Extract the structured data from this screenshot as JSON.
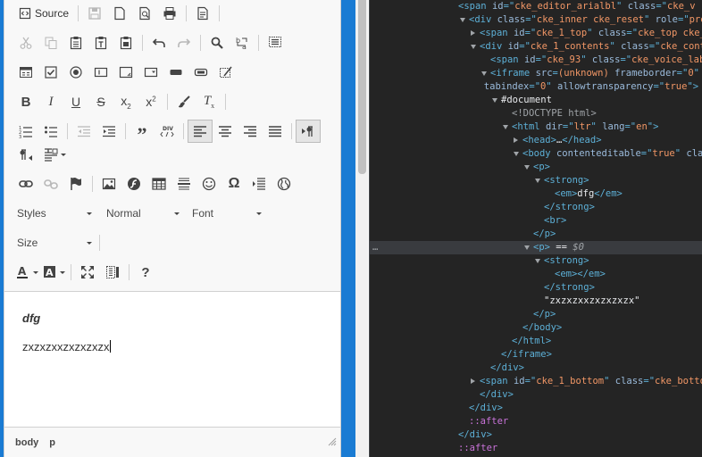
{
  "toolbar": {
    "source_label": "Source",
    "styles_label": "Styles",
    "format_label": "Normal",
    "font_label": "Font",
    "size_label": "Size",
    "help_label": "?"
  },
  "content": {
    "line1": "dfg",
    "line2": "zxzxzxxzxzxzxzx"
  },
  "status": {
    "path": [
      "body",
      "p"
    ]
  },
  "devtools": {
    "lines": [
      {
        "indent": 0,
        "parts": [
          [
            "t",
            "<span "
          ],
          [
            "a",
            "id"
          ],
          [
            "t",
            "=\""
          ],
          [
            "v",
            "cke_editor_arialbl"
          ],
          [
            "t",
            "\" "
          ],
          [
            "a",
            "class"
          ],
          [
            "t",
            "=\""
          ],
          [
            "v",
            "cke_v"
          ]
        ]
      },
      {
        "indent": 1,
        "tri": "down",
        "parts": [
          [
            "t",
            "<div "
          ],
          [
            "a",
            "class"
          ],
          [
            "t",
            "=\""
          ],
          [
            "v",
            "cke_inner cke_reset"
          ],
          [
            "t",
            "\" "
          ],
          [
            "a",
            "role"
          ],
          [
            "t",
            "=\""
          ],
          [
            "v",
            "pre"
          ]
        ]
      },
      {
        "indent": 2,
        "tri": "right",
        "parts": [
          [
            "t",
            "<span "
          ],
          [
            "a",
            "id"
          ],
          [
            "t",
            "=\""
          ],
          [
            "v",
            "cke_1_top"
          ],
          [
            "t",
            "\" "
          ],
          [
            "a",
            "class"
          ],
          [
            "t",
            "=\""
          ],
          [
            "v",
            "cke_top cke_"
          ]
        ]
      },
      {
        "indent": 2,
        "tri": "down",
        "parts": [
          [
            "t",
            "<div "
          ],
          [
            "a",
            "id"
          ],
          [
            "t",
            "=\""
          ],
          [
            "v",
            "cke_1_contents"
          ],
          [
            "t",
            "\" "
          ],
          [
            "a",
            "class"
          ],
          [
            "t",
            "=\""
          ],
          [
            "v",
            "cke_cont"
          ]
        ]
      },
      {
        "indent": 3,
        "parts": [
          [
            "t",
            "<span "
          ],
          [
            "a",
            "id"
          ],
          [
            "t",
            "=\""
          ],
          [
            "v",
            "cke_93"
          ],
          [
            "t",
            "\" "
          ],
          [
            "a",
            "class"
          ],
          [
            "t",
            "=\""
          ],
          [
            "v",
            "cke_voice_lab"
          ]
        ]
      },
      {
        "indent": 3,
        "tri": "down",
        "parts": [
          [
            "t",
            "<iframe "
          ],
          [
            "a",
            "src"
          ],
          [
            "t",
            "="
          ],
          [
            "v",
            "(unknown)"
          ],
          [
            "t",
            " "
          ],
          [
            "a",
            "frameborder"
          ],
          [
            "t",
            "=\""
          ],
          [
            "v",
            "0"
          ],
          [
            "t",
            "\" "
          ],
          [
            "a",
            "cl"
          ]
        ]
      },
      {
        "indent": 2.4,
        "parts": [
          [
            "a",
            "tabindex"
          ],
          [
            "t",
            "=\""
          ],
          [
            "v",
            "0"
          ],
          [
            "t",
            "\" "
          ],
          [
            "a",
            "allowtransparency"
          ],
          [
            "t",
            "=\""
          ],
          [
            "v",
            "true"
          ],
          [
            "t",
            "\">"
          ]
        ]
      },
      {
        "indent": 4,
        "tri": "down",
        "parts": [
          [
            "c",
            "#document"
          ]
        ]
      },
      {
        "indent": 5,
        "parts": [
          [
            "g",
            "<!DOCTYPE html>"
          ]
        ]
      },
      {
        "indent": 5,
        "tri": "down",
        "parts": [
          [
            "t",
            "<html "
          ],
          [
            "a",
            "dir"
          ],
          [
            "t",
            "=\""
          ],
          [
            "v",
            "ltr"
          ],
          [
            "t",
            "\" "
          ],
          [
            "a",
            "lang"
          ],
          [
            "t",
            "=\""
          ],
          [
            "v",
            "en"
          ],
          [
            "t",
            "\">"
          ]
        ]
      },
      {
        "indent": 6,
        "tri": "right",
        "parts": [
          [
            "t",
            "<head>"
          ],
          [
            "c",
            "…"
          ],
          [
            "t",
            "</head>"
          ]
        ]
      },
      {
        "indent": 6,
        "tri": "down",
        "parts": [
          [
            "t",
            "<body "
          ],
          [
            "a",
            "contenteditable"
          ],
          [
            "t",
            "=\""
          ],
          [
            "v",
            "true"
          ],
          [
            "t",
            "\" "
          ],
          [
            "a",
            "class"
          ]
        ]
      },
      {
        "indent": 7,
        "tri": "down",
        "parts": [
          [
            "t",
            "<p>"
          ]
        ]
      },
      {
        "indent": 8,
        "tri": "down",
        "parts": [
          [
            "t",
            "<strong>"
          ]
        ]
      },
      {
        "indent": 9,
        "parts": [
          [
            "t",
            "<em>"
          ],
          [
            "c",
            "dfg"
          ],
          [
            "t",
            "</em>"
          ]
        ]
      },
      {
        "indent": 8,
        "parts": [
          [
            "t",
            "</strong>"
          ]
        ]
      },
      {
        "indent": 8,
        "parts": [
          [
            "t",
            "<br>"
          ]
        ]
      },
      {
        "indent": 7,
        "parts": [
          [
            "t",
            "</p>"
          ]
        ]
      },
      {
        "indent": 7,
        "tri": "down",
        "sel": true,
        "parts": [
          [
            "t",
            "<p>"
          ],
          [
            "c",
            " == "
          ],
          [
            "dollar",
            "$0"
          ]
        ]
      },
      {
        "indent": 8,
        "tri": "down",
        "parts": [
          [
            "t",
            "<strong>"
          ]
        ]
      },
      {
        "indent": 9,
        "parts": [
          [
            "t",
            "<em></em>"
          ]
        ]
      },
      {
        "indent": 8,
        "parts": [
          [
            "t",
            "</strong>"
          ]
        ]
      },
      {
        "indent": 8,
        "parts": [
          [
            "c",
            "\"zxzxzxxzxzxzxzx\""
          ]
        ]
      },
      {
        "indent": 7,
        "parts": [
          [
            "t",
            "</p>"
          ]
        ]
      },
      {
        "indent": 6,
        "parts": [
          [
            "t",
            "</body>"
          ]
        ]
      },
      {
        "indent": 5,
        "parts": [
          [
            "t",
            "</html>"
          ]
        ]
      },
      {
        "indent": 4,
        "parts": [
          [
            "t",
            "</iframe>"
          ]
        ]
      },
      {
        "indent": 3,
        "parts": [
          [
            "t",
            "</div>"
          ]
        ]
      },
      {
        "indent": 2,
        "tri": "right",
        "parts": [
          [
            "t",
            "<span "
          ],
          [
            "a",
            "id"
          ],
          [
            "t",
            "=\""
          ],
          [
            "v",
            "cke_1_bottom"
          ],
          [
            "t",
            "\" "
          ],
          [
            "a",
            "class"
          ],
          [
            "t",
            "=\""
          ],
          [
            "v",
            "cke_botto"
          ]
        ]
      },
      {
        "indent": 2,
        "parts": [
          [
            "t",
            "</div>"
          ]
        ]
      },
      {
        "indent": 1,
        "parts": [
          [
            "t",
            "</div>"
          ]
        ]
      },
      {
        "indent": 1,
        "parts": [
          [
            "pe",
            "::after"
          ]
        ]
      },
      {
        "indent": 0,
        "parts": [
          [
            "t",
            "</div>"
          ]
        ]
      },
      {
        "indent": 0,
        "parts": [
          [
            "pe",
            "::after"
          ]
        ]
      }
    ]
  }
}
